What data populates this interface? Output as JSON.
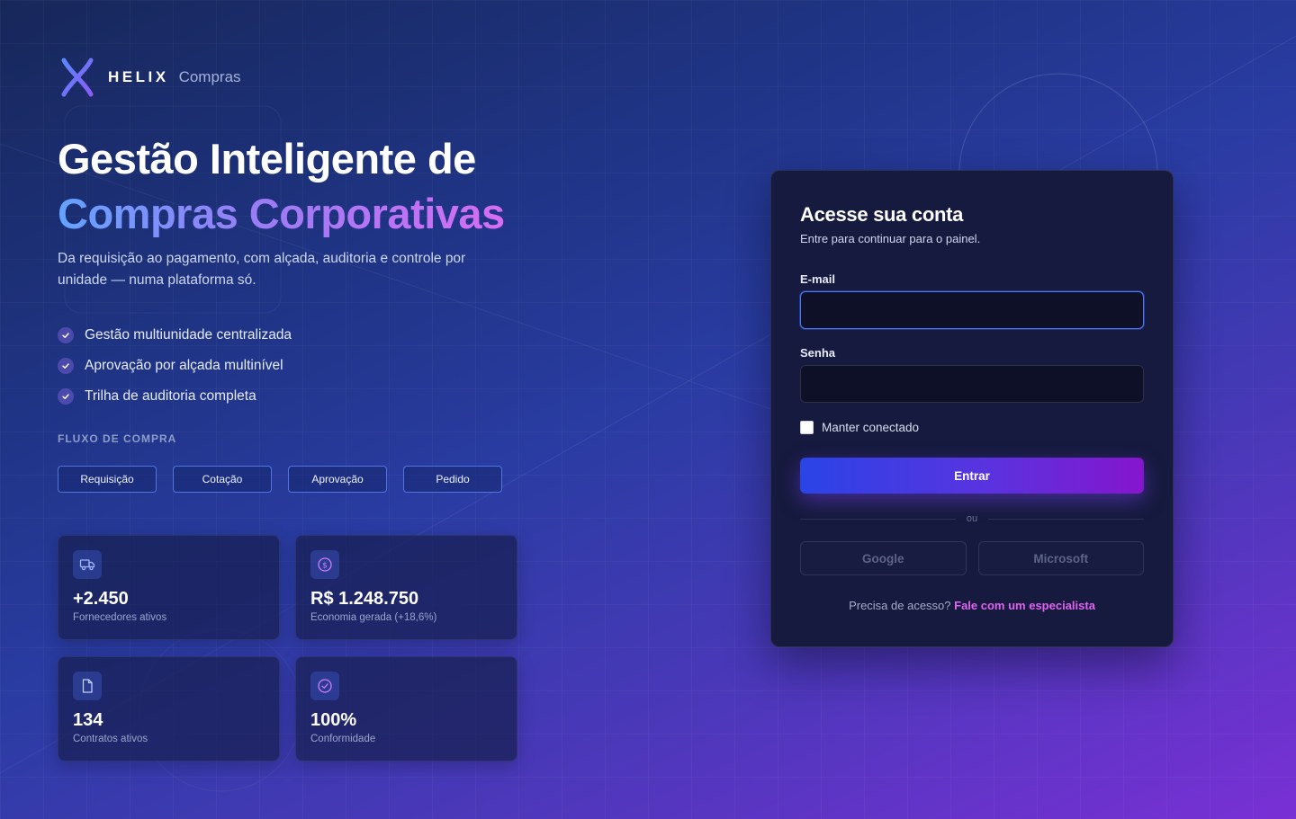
{
  "brand": {
    "name": "HELIX",
    "product": "Compras"
  },
  "hero": {
    "title_line1": "Gestão Inteligente de",
    "title_line2": "Compras Corporativas",
    "description": "Da requisição ao pagamento, com alçada, auditoria e controle por unidade — numa plataforma só."
  },
  "features": [
    "Gestão multiunidade centralizada",
    "Aprovação por alçada multinível",
    "Trilha de auditoria completa"
  ],
  "flow": {
    "title": "FLUXO DE COMPRA",
    "steps": [
      "Requisição",
      "Cotação",
      "Aprovação",
      "Pedido"
    ]
  },
  "stats": [
    {
      "icon": "truck-icon",
      "value": "+2.450",
      "label": "Fornecedores ativos"
    },
    {
      "icon": "dollar-circle-icon",
      "value": "R$ 1.248.750",
      "label": "Economia gerada (+18,6%)"
    },
    {
      "icon": "document-icon",
      "value": "134",
      "label": "Contratos ativos"
    },
    {
      "icon": "check-circle-icon",
      "value": "100%",
      "label": "Conformidade"
    }
  ],
  "login": {
    "title": "Acesse sua conta",
    "subtitle": "Entre para continuar para o painel.",
    "email_label": "E-mail",
    "email_value": "",
    "password_label": "Senha",
    "password_value": "",
    "remember_label": "Manter conectado",
    "submit_label": "Entrar",
    "divider_text": "ou",
    "sso": [
      "Google",
      "Microsoft"
    ],
    "help_text": "Precisa de acesso?",
    "help_link": "Fale com um especialista"
  },
  "colors": {
    "accent_blue": "#2a44e6",
    "accent_purple": "#8515cd",
    "link_pink": "#e063f0",
    "card_bg": "#161a3e"
  }
}
